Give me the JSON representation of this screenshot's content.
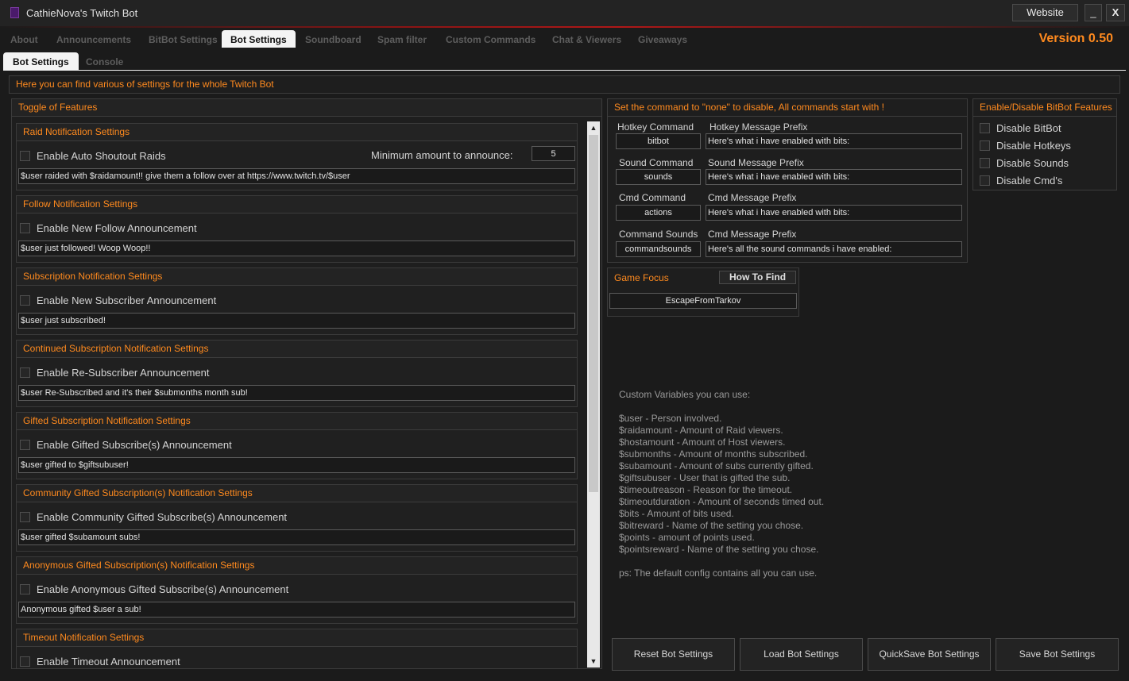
{
  "window": {
    "title": "CathieNova's Twitch Bot",
    "website_label": "Website",
    "minimize_label": "_",
    "close_label": "X"
  },
  "tabs": [
    "About",
    "Announcements",
    "BitBot Settings",
    "Bot Settings",
    "Soundboard",
    "Spam filter",
    "Custom Commands",
    "Chat & Viewers",
    "Giveaways"
  ],
  "active_tab": "Bot Settings",
  "version": "Version 0.50",
  "subtabs": [
    "Bot Settings",
    "Console"
  ],
  "info_text": "Here you can find various of settings for the whole Twitch Bot",
  "features": {
    "title": "Toggle of Features",
    "groups": [
      {
        "title": "Raid Notification Settings",
        "checkbox": "Enable Auto Shoutout Raids",
        "message": "$user raided with $raidamount!! give them a follow over at https://www.twitch.tv/$user",
        "min_label": "Minimum amount to announce:",
        "min_value": "5"
      },
      {
        "title": "Follow Notification Settings",
        "checkbox": "Enable New Follow Announcement",
        "message": "$user just followed! Woop Woop!!"
      },
      {
        "title": "Subscription Notification Settings",
        "checkbox": "Enable New Subscriber Announcement",
        "message": "$user just subscribed!"
      },
      {
        "title": "Continued Subscription Notification Settings",
        "checkbox": "Enable Re-Subscriber Announcement",
        "message": "$user Re-Subscribed and it's their $submonths month sub!"
      },
      {
        "title": "Gifted Subscription Notification Settings",
        "checkbox": "Enable Gifted Subscribe(s) Announcement",
        "message": "$user gifted to $giftsubuser!"
      },
      {
        "title": "Community Gifted Subscription(s) Notification Settings",
        "checkbox": "Enable Community Gifted Subscribe(s) Announcement",
        "message": "$user gifted $subamount subs!"
      },
      {
        "title": "Anonymous Gifted Subscription(s) Notification Settings",
        "checkbox": "Enable Anonymous Gifted Subscribe(s) Announcement",
        "message": "Anonymous gifted $user a sub!"
      },
      {
        "title": "Timeout Notification Settings",
        "checkbox": "Enable Timeout Announcement"
      }
    ]
  },
  "commands": {
    "title": "Set the command to \"none\" to disable, All commands start with !",
    "rows": [
      {
        "cmd_label": "Hotkey Command",
        "cmd_value": "bitbot",
        "prefix_label": "Hotkey Message Prefix",
        "prefix_value": "Here's what i have enabled with bits:"
      },
      {
        "cmd_label": "Sound Command",
        "cmd_value": "sounds",
        "prefix_label": "Sound Message Prefix",
        "prefix_value": "Here's what i have enabled with bits:"
      },
      {
        "cmd_label": "Cmd Command",
        "cmd_value": "actions",
        "prefix_label": "Cmd Message Prefix",
        "prefix_value": "Here's what i have enabled with bits:"
      },
      {
        "cmd_label": "Command Sounds",
        "cmd_value": "commandsounds",
        "prefix_label": "Cmd Message Prefix",
        "prefix_value": "Here's all the sound commands i have enabled:"
      }
    ]
  },
  "game_focus": {
    "title": "Game Focus",
    "button": "How To Find",
    "value": "EscapeFromTarkov"
  },
  "bitbot_features": {
    "title": "Enable/Disable BitBot Features",
    "items": [
      "Disable BitBot",
      "Disable Hotkeys",
      "Disable Sounds",
      "Disable Cmd's"
    ]
  },
  "variables": "Custom Variables you can use:\n\n$user - Person involved.\n$raidamount - Amount of Raid viewers.\n$hostamount - Amount of Host viewers.\n$submonths - Amount of months subscribed.\n$subamount - Amount of subs currently gifted.\n$giftsubuser - User that is gifted the sub.\n$timeoutreason - Reason for the timeout.\n$timeoutduration - Amount of seconds timed out.\n$bits - Amount of bits used.\n$bitreward - Name of the setting you chose.\n$points - amount of points used.\n$pointsreward - Name of the setting you chose.\n\nps: The default config contains all you can use.",
  "buttons": [
    "Reset Bot Settings",
    "Load Bot Settings",
    "QuickSave Bot Settings",
    "Save Bot Settings"
  ],
  "colors": {
    "accent": "#ff8a1e",
    "background": "#1b1b1b",
    "titlebar_line": "#b01818"
  }
}
